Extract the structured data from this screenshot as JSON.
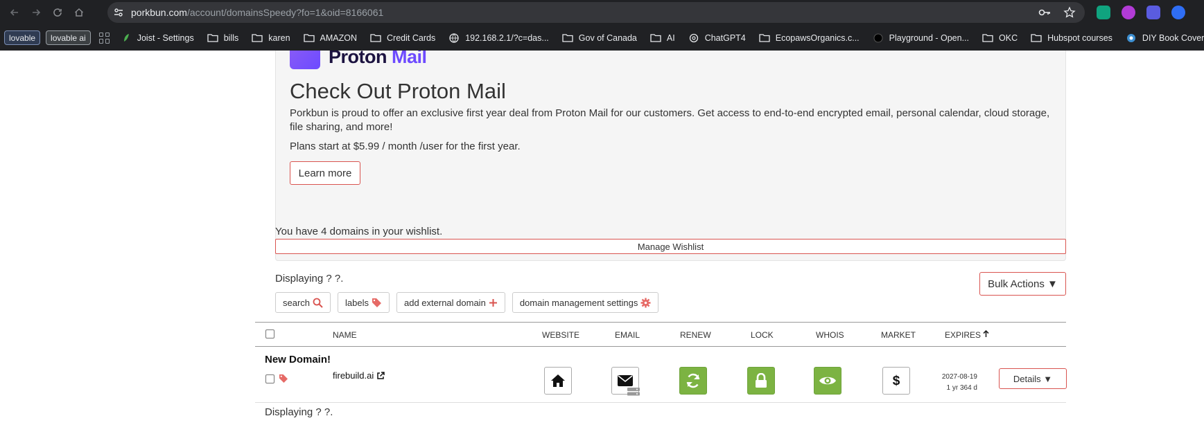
{
  "browser": {
    "url_host": "porkbun.com",
    "url_path": "/account/domainsSpeedy?fo=1&oid=8166061",
    "bookmarks": [
      {
        "label": "lovable",
        "type": "pill"
      },
      {
        "label": "lovable ai",
        "type": "pill"
      },
      {
        "label": "Joist - Settings",
        "icon": "leaf-icon"
      },
      {
        "label": "bills",
        "icon": "folder-icon"
      },
      {
        "label": "karen",
        "icon": "folder-icon"
      },
      {
        "label": "AMAZON",
        "icon": "folder-icon"
      },
      {
        "label": "Credit Cards",
        "icon": "folder-icon"
      },
      {
        "label": "192.168.2.1/?c=das...",
        "icon": "globe-icon"
      },
      {
        "label": "Gov of Canada",
        "icon": "folder-icon"
      },
      {
        "label": "AI",
        "icon": "folder-icon"
      },
      {
        "label": "ChatGPT4",
        "icon": "openai-icon"
      },
      {
        "label": "EcopawsOrganics.c...",
        "icon": "folder-icon"
      },
      {
        "label": "Playground - Open...",
        "icon": "openai-dark-icon"
      },
      {
        "label": "OKC",
        "icon": "folder-icon"
      },
      {
        "label": "Hubspot courses",
        "icon": "folder-icon"
      },
      {
        "label": "DIY Book Covers",
        "icon": "book-icon"
      }
    ]
  },
  "promo": {
    "logo_text_a": "Proton",
    "logo_text_b": "Mail",
    "title": "Check Out Proton Mail",
    "text": "Porkbun is proud to offer an exclusive first year deal from Proton Mail for our customers. Get access to end-to-end encrypted email, personal calendar, cloud storage, file sharing, and more!",
    "plans": "Plans start at $5.99 / month /user for the first year.",
    "learn_more": "Learn more"
  },
  "wishlist": {
    "text": "You have 4 domains in your wishlist.",
    "button": "Manage Wishlist"
  },
  "domains": {
    "displaying_top": "Displaying ? ?.",
    "displaying_bottom": "Displaying ? ?.",
    "bulk_actions": "Bulk Actions ▼",
    "tools": {
      "search": "search",
      "labels": "labels",
      "add_external": "add external domain",
      "settings": "domain management settings"
    },
    "columns": {
      "name": "NAME",
      "website": "WEBSITE",
      "email": "EMAIL",
      "renew": "RENEW",
      "lock": "LOCK",
      "whois": "WHOIS",
      "market": "MARKET",
      "expires": "EXPIRES"
    },
    "rows": [
      {
        "group": "New Domain!",
        "name": "firebuild.ai",
        "expires_date": "2027-08-19",
        "expires_left": "1 yr 364 d",
        "details": "Details ▼"
      }
    ]
  },
  "colors": {
    "accent_red": "#d9534f",
    "green": "#7cb342",
    "proton_purple": "#6d4aff"
  }
}
